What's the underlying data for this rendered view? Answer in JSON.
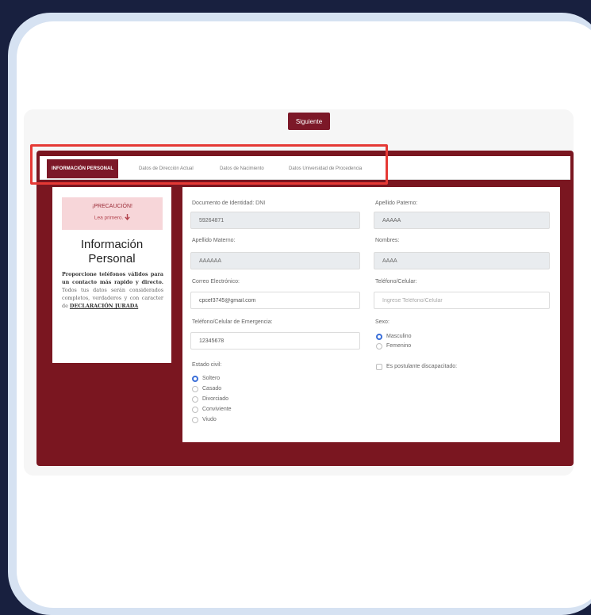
{
  "header": {
    "next_button": "Siguiente"
  },
  "tabs": [
    {
      "label": "INFORMACIÓN PERSONAL",
      "active": true
    },
    {
      "label": "Datos de Dirección Actual",
      "active": false
    },
    {
      "label": "Datos de Nacimiento",
      "active": false
    },
    {
      "label": "Datos Universidad de Procedencia",
      "active": false
    }
  ],
  "sidebar": {
    "warning_title": "¡PRECAUCIÓN!",
    "warning_sub": "Lea primero.",
    "warning_icon": "arrow-down-icon",
    "title": "Información Personal",
    "text_bold": "Proporcione teléfonos válidos para un contacto más rapido y directo.",
    "text_normal": " Todos tus datos serán considerados completos, verdaderos y con caracter de ",
    "text_emph": "DECLARACIÓN JURADA"
  },
  "form": {
    "dni_label": "Documento de Identidad: DNI",
    "dni_value": "59264871",
    "paterno_label": "Apellido Paterno:",
    "paterno_value": "AAAAA",
    "materno_label": "Apellido Materno:",
    "materno_value": "AAAAAA",
    "nombres_label": "Nombres:",
    "nombres_value": "AAAA",
    "email_label": "Correo Electrónico:",
    "email_value": "cpcef3745@gmail.com",
    "telefono_label": "Teléfono/Celular:",
    "telefono_placeholder": "Ingrese Teléfono/Celular",
    "emergencia_label": "Teléfono/Celular de Emergencia:",
    "emergencia_value": "12345678",
    "sexo_label": "Sexo:",
    "sexo_options": [
      "Masculino",
      "Femenino"
    ],
    "estado_label": "Estado civil:",
    "estado_options": [
      "Soltero",
      "Casado",
      "Divorciado",
      "Conviviente",
      "Viudo"
    ],
    "discapacidad_label": "Es postulante discapacitado:"
  },
  "colors": {
    "accent": "#7c1828",
    "highlight": "#e53935",
    "radio": "#3b6fd8"
  }
}
